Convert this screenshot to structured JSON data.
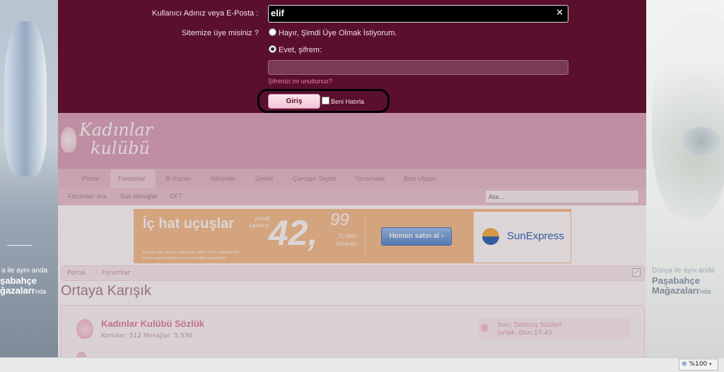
{
  "login": {
    "username_label": "Kullanıcı Adınız veya E-Posta :",
    "username_value": "elif",
    "clear_glyph": "✕",
    "member_question": "Sitemize üye misiniz ?",
    "option_no": "Hayır, Şimdi Üye Olmak İstiyorum.",
    "option_yes": "Evet, şifrem:",
    "forgot": "Şifrenizi mi unuttunuz?",
    "login_button": "Giriş",
    "remember": "Beni Hatırla"
  },
  "logo": {
    "line1": "Kadınlar",
    "line2": "kulübü"
  },
  "nav": {
    "items": [
      "Portal",
      "Forumlar",
      "Bi Kazan",
      "Albümler",
      "Üyeler",
      "Çamaşır Sepeti",
      "Yarışmalar",
      "Bize Ulaşın"
    ]
  },
  "subnav": {
    "items": [
      "Forumları Ara",
      "Son Mesajlar",
      "OFT"
    ],
    "search_placeholder": "Ara..."
  },
  "banner": {
    "headline": "İç hat uçuşlar",
    "price_prefix_1": "şimdi",
    "price_prefix_2": "sadece",
    "price_main": "42,",
    "price_cents": "99",
    "price_suffix_1": "TL'den",
    "price_suffix_2": "itibaren",
    "fine_print_1": "Fiyatlar tek yön için, havayolu dahil ve TL cinsindendir.",
    "fine_print_2": "Sınırlı sayıda koltuk şartsız kuraldaki uçuşlarda.",
    "cta": "Hemen satın al ›",
    "brand": "SunExpress"
  },
  "breadcrumb": {
    "items": [
      "Portal",
      "Forumlar"
    ]
  },
  "page_title": "Ortaya Karışık",
  "forum": {
    "title": "Kadınlar Kulübü Sözlük",
    "stats_label_threads": "Konular:",
    "stats_threads": "512",
    "stats_label_posts": "Mesajlar:",
    "stats_posts": "5.530",
    "last_label": "Son:",
    "last_title": "Dolmuş Süsleri",
    "last_user": "sırlak,",
    "last_time": "Dün 17:45"
  },
  "left_ad": {
    "line1": "a ile aynı anda",
    "line2": "şabahçe",
    "line3": "ğazaları",
    "line4": "'nda"
  },
  "right_ad": {
    "line1": "Dünya ile aynı anda",
    "line2": "Paşabahçe",
    "line3": "Mağazaları",
    "line4": "'nda"
  },
  "statusbar": {
    "zoom": "%100"
  },
  "colors": {
    "login_bg": "#5a0f2d",
    "header_bg": "#dca9bd",
    "accent_pink": "#e84f8c",
    "banner_bg": "#f5c491"
  }
}
